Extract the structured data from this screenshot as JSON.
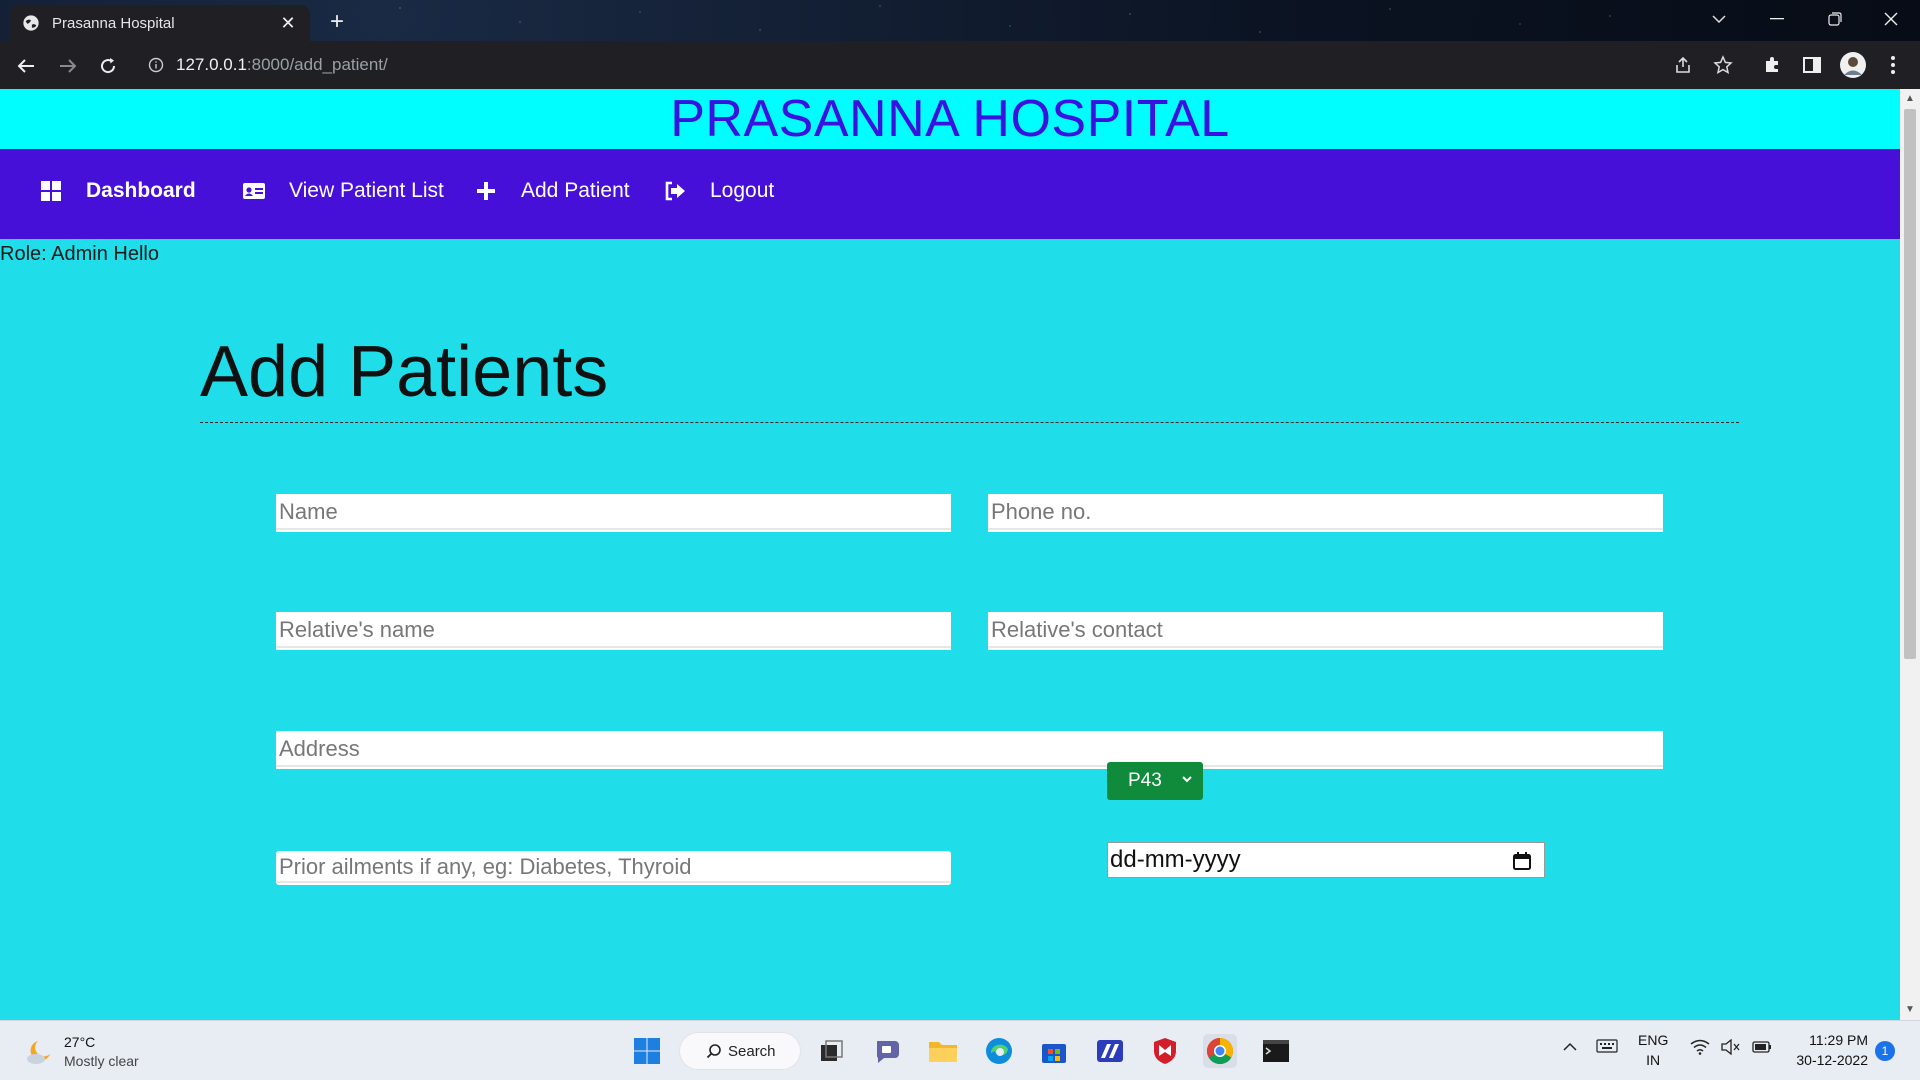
{
  "browser": {
    "tab_title": "Prasanna Hospital",
    "url_host": "127.0.0.1",
    "url_path": ":8000/add_patient/"
  },
  "site": {
    "brand": "PRASANNA HOSPITAL",
    "nav": [
      {
        "label": "Dashboard",
        "icon": "dashboard-grid-icon"
      },
      {
        "label": "View Patient List",
        "icon": "id-card-icon"
      },
      {
        "label": "Add Patient",
        "icon": "plus-icon"
      },
      {
        "label": "Logout",
        "icon": "logout-icon"
      }
    ],
    "role_text": "Role: Admin Hello"
  },
  "form": {
    "title": "Add Patients",
    "name_placeholder": "Name",
    "phone_placeholder": "Phone no.",
    "relative_name_placeholder": "Relative's name",
    "relative_contact_placeholder": "Relative's contact",
    "address_placeholder": "Address",
    "ailments_placeholder": "Prior ailments if any, eg: Diabetes, Thyroid",
    "patient_id_selected": "P43",
    "date_placeholder": "dd-mm-yyyy"
  },
  "taskbar": {
    "weather_temp": "27°C",
    "weather_cond": "Mostly clear",
    "search_label": "Search",
    "lang_top": "ENG",
    "lang_bottom": "IN",
    "time": "11:29 PM",
    "date": "30-12-2022",
    "notification_count": "1"
  },
  "colors": {
    "brand_bar": "#00fdff",
    "brand_text": "#3a12e0",
    "nav_bg": "#4610d8",
    "page_bg": "#1fdde9",
    "select_bg": "#108a3b"
  }
}
